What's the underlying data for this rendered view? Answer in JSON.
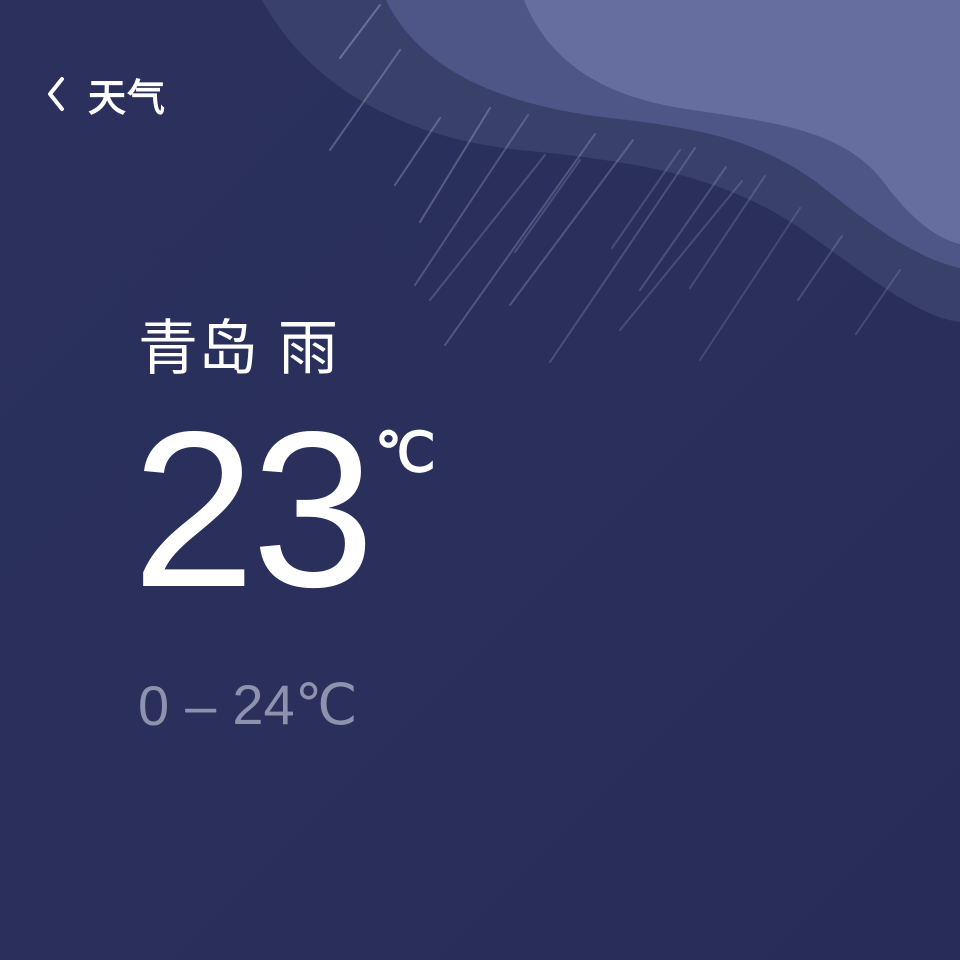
{
  "header": {
    "back_icon": "chevron-left-icon",
    "title": "天气"
  },
  "weather": {
    "city": "青岛",
    "condition": "雨",
    "temperature": "23",
    "temperature_unit": "℃",
    "range_low": "0",
    "range_separator": "–",
    "range_high": "24℃"
  },
  "colors": {
    "background": "#2a2f5b",
    "cloud_layer_1": "#39406a",
    "cloud_layer_2": "#4e5587",
    "cloud_layer_3": "#666e9f",
    "secondary_text": "#8e92ad",
    "primary_text": "#ffffff"
  }
}
